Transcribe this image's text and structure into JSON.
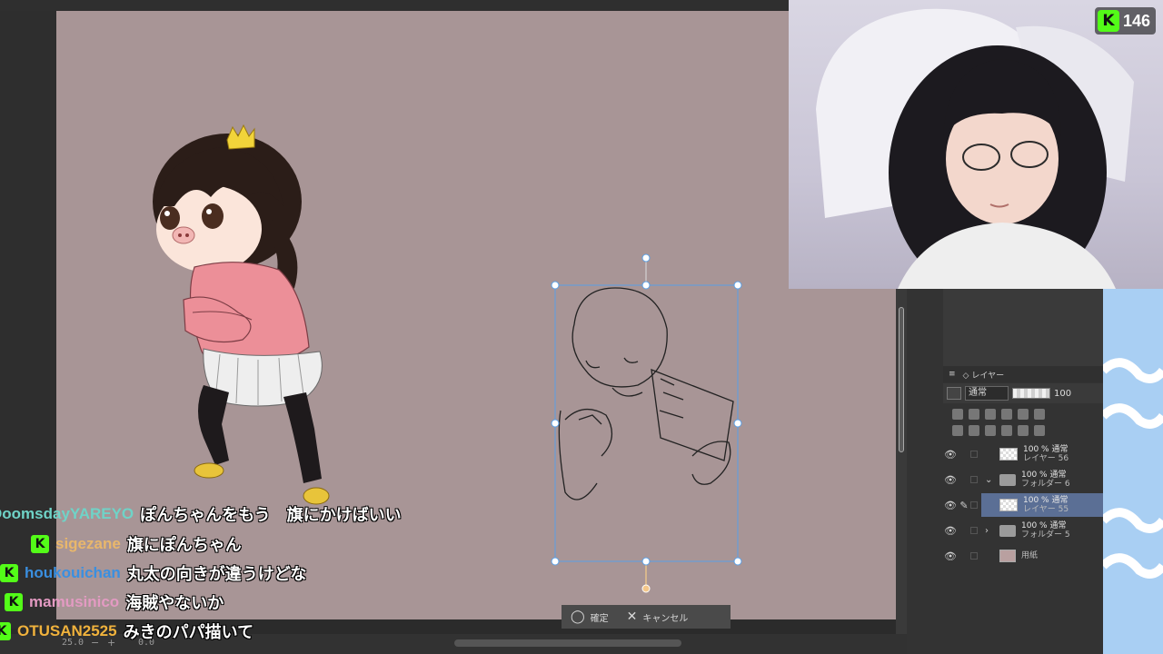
{
  "stream": {
    "viewer_count": "146",
    "kick_logo": "K"
  },
  "canvas": {
    "background_color": "#a89596"
  },
  "transform_bar": {
    "confirm_label": "確定",
    "cancel_label": "キャンセル",
    "confirm_icon": "check-circle-icon",
    "cancel_icon": "close-icon"
  },
  "statusbar": {
    "zoom": "25.0",
    "angle": "0.0"
  },
  "layer_panel": {
    "tab_label": "レイヤー",
    "blend_mode": "通常",
    "opacity": "100",
    "layers": [
      {
        "mode": "100 % 通常",
        "name": "レイヤー 56",
        "type": "raster"
      },
      {
        "mode": "100 % 通常",
        "name": "フォルダー 6",
        "type": "folder-open"
      },
      {
        "mode": "100 % 通常",
        "name": "レイヤー 55",
        "type": "raster",
        "selected": true
      },
      {
        "mode": "100 % 通常",
        "name": "フォルダー 5",
        "type": "folder-closed"
      },
      {
        "mode": "",
        "name": "用紙",
        "type": "paper"
      }
    ]
  },
  "chat": [
    {
      "user": "DoomsdayYAREYO",
      "user_color": "#6fd3c7",
      "message": "ぽんちゃんをもう　旗にかけばいい",
      "badge": false
    },
    {
      "user": "sigezane",
      "user_color": "#e9b76b",
      "message": "旗にぽんちゃん",
      "badge": true
    },
    {
      "user": "houkouichan",
      "user_color": "#3a8fe0",
      "message": "丸太の向きが違うけどな",
      "badge": true
    },
    {
      "user": "mamusinico",
      "user_color": "#e39ac2",
      "message": "海賊やないか",
      "badge": true
    },
    {
      "user": "OTUSAN2525",
      "user_color": "#f0b23c",
      "message": "みきのパパ描いて",
      "badge": true
    }
  ]
}
